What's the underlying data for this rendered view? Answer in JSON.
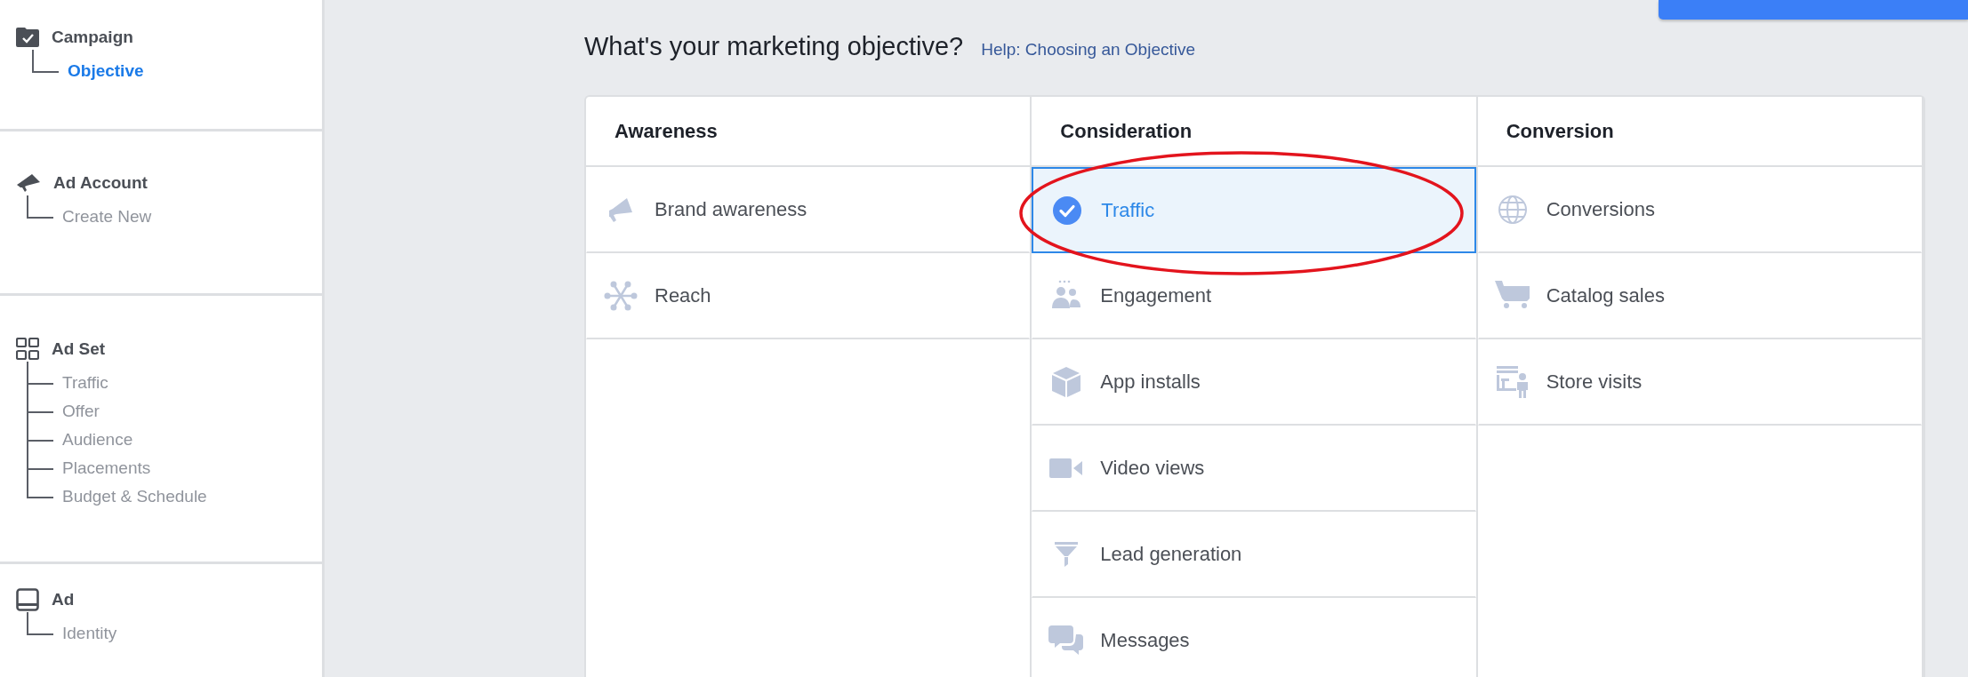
{
  "sidebar": {
    "sections": [
      {
        "title": "Campaign",
        "kind": "campaign",
        "children": [
          {
            "label": "Objective",
            "selected": true
          }
        ]
      },
      {
        "title": "Ad Account",
        "kind": "account",
        "children": [
          {
            "label": "Create New",
            "selected": false
          }
        ]
      },
      {
        "title": "Ad Set",
        "kind": "adset",
        "children": [
          {
            "label": "Traffic",
            "selected": false
          },
          {
            "label": "Offer",
            "selected": false
          },
          {
            "label": "Audience",
            "selected": false
          },
          {
            "label": "Placements",
            "selected": false
          },
          {
            "label": "Budget & Schedule",
            "selected": false
          }
        ]
      },
      {
        "title": "Ad",
        "kind": "ad",
        "children": [
          {
            "label": "Identity",
            "selected": false
          }
        ]
      }
    ]
  },
  "title": "What's your marketing objective?",
  "help_link": "Help: Choosing an Objective",
  "columns": [
    {
      "heading": "Awareness",
      "items": [
        {
          "label": "Brand awareness",
          "kind": "megaphone",
          "selected": false
        },
        {
          "label": "Reach",
          "kind": "reach",
          "selected": false
        }
      ]
    },
    {
      "heading": "Consideration",
      "items": [
        {
          "label": "Traffic",
          "kind": "traffic",
          "selected": true
        },
        {
          "label": "Engagement",
          "kind": "people",
          "selected": false
        },
        {
          "label": "App installs",
          "kind": "cube",
          "selected": false
        },
        {
          "label": "Video views",
          "kind": "video",
          "selected": false
        },
        {
          "label": "Lead generation",
          "kind": "funnel",
          "selected": false
        },
        {
          "label": "Messages",
          "kind": "chat",
          "selected": false
        }
      ]
    },
    {
      "heading": "Conversion",
      "items": [
        {
          "label": "Conversions",
          "kind": "globe",
          "selected": false
        },
        {
          "label": "Catalog sales",
          "kind": "cart",
          "selected": false
        },
        {
          "label": "Store visits",
          "kind": "store",
          "selected": false
        }
      ]
    }
  ]
}
